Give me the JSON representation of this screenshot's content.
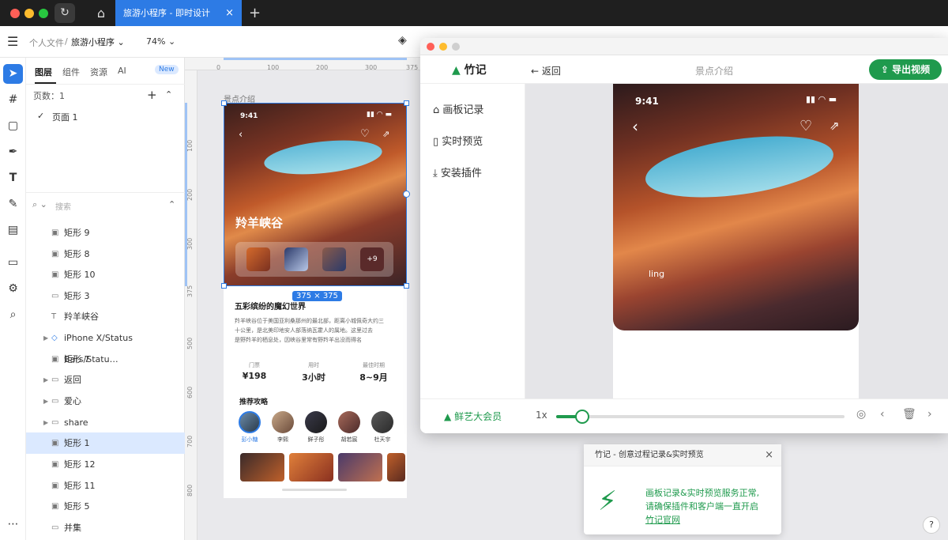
{
  "browser": {
    "tab_title": "旅游小程序 - 即时设计",
    "new_tab": "+",
    "close": "×"
  },
  "toolbar": {
    "crumb_root": "个人文件",
    "crumb_sep": "/",
    "crumb_file": "旅游小程序 ⌄",
    "zoom": "74% ⌄"
  },
  "panel": {
    "tabs": [
      "图层",
      "组件",
      "资源",
      "AI"
    ],
    "new_badge": "New",
    "pages_label": "页数：1",
    "page_item": "页面 1",
    "search_placeholder": "搜索",
    "layers": [
      {
        "icon": "image",
        "label": "矩形 9"
      },
      {
        "icon": "image",
        "label": "矩形 8"
      },
      {
        "icon": "image",
        "label": "矩形 10"
      },
      {
        "icon": "line",
        "label": "矩形 3"
      },
      {
        "icon": "text",
        "label": "羚羊峡谷"
      },
      {
        "icon": "component",
        "label": "iPhone X/Status Bars/Statu…"
      },
      {
        "icon": "image",
        "label": "矩形 7"
      },
      {
        "icon": "folder",
        "label": "返回"
      },
      {
        "icon": "folder",
        "label": "爱心"
      },
      {
        "icon": "folder",
        "label": "share"
      },
      {
        "icon": "image",
        "label": "矩形 1"
      },
      {
        "icon": "image",
        "label": "矩形 12"
      },
      {
        "icon": "image",
        "label": "矩形 11"
      },
      {
        "icon": "image",
        "label": "矩形 5"
      },
      {
        "icon": "line",
        "label": "并集"
      }
    ]
  },
  "canvas": {
    "frame_label": "景点介绍",
    "ruler_top": [
      "0",
      "100",
      "200",
      "300",
      "375"
    ],
    "ruler_left": [
      "100",
      "200",
      "300",
      "375",
      "500",
      "600",
      "700",
      "800"
    ],
    "size_badge": "375 × 375",
    "mock": {
      "time": "9:41",
      "place": "羚羊峡谷",
      "more": "+9",
      "heading": "五彩缤纷的魔幻世界",
      "body1": "羚羊峡谷位于美国亚利桑那州的最北部，距离小城佩奇大约三",
      "body2": "十公里，是北美印地安人部落纳瓦霍人的属地。这里过去",
      "body3": "是野羚羊的栖息处，因峡谷里常有野羚羊出没而得名",
      "stats": [
        {
          "label": "门票",
          "value": "¥198"
        },
        {
          "label": "用时",
          "value": "3小时"
        },
        {
          "label": "最佳时期",
          "value": "8~9月"
        }
      ],
      "guide_heading": "推荐攻略",
      "avatars": [
        "彭小糖",
        "李熙",
        "鲜子彤",
        "胡若宸",
        "杜天宇"
      ]
    }
  },
  "preview": {
    "app_name": "竹记",
    "back": "← 返回",
    "page_title": "景点介绍",
    "export": "⇪ 导出视频",
    "sidebar": [
      "画板记录",
      "实时预览",
      "安装插件"
    ],
    "phone_time": "9:41",
    "caption": "ling",
    "member": "鲜艺大会员",
    "speed": "1x",
    "progress": 0.09
  },
  "notification": {
    "title": "竹记 - 创意过程记录&实时预览",
    "line1": "画板记录&实时预览服务正常,",
    "line2": "请确保插件和客户端一直开启",
    "link": "竹记官网"
  },
  "help": "?",
  "colors": {
    "accent": "#2d7be5",
    "brand_green": "#1f9a4d"
  }
}
